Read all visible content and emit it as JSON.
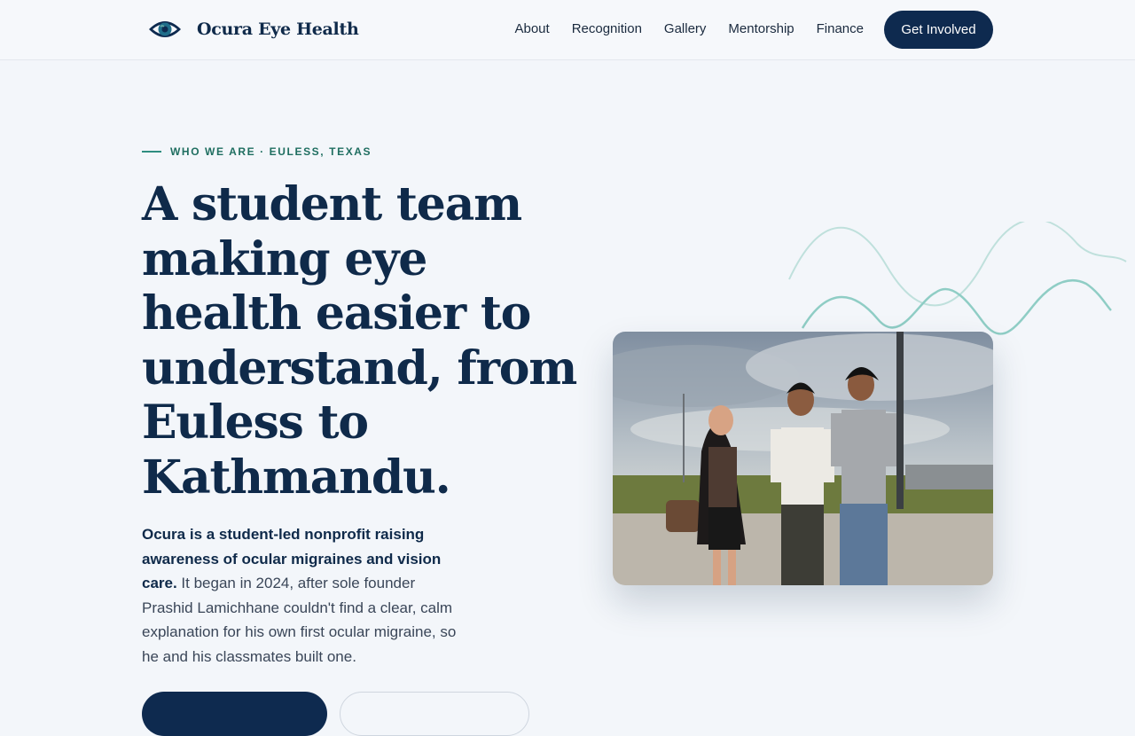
{
  "nav": {
    "brand_name": "Ocura Eye Health",
    "links": [
      "About",
      "Recognition",
      "Gallery",
      "Mentorship",
      "Finance"
    ],
    "cta_label": "Get Involved"
  },
  "hero": {
    "eyebrow": "WHO WE ARE · EULESS, TEXAS",
    "headline": "A student team making eye health easier to understand, from Euless to Kathmandu.",
    "lead_bold": "Ocura is a student-led nonprofit raising awareness of ocular migraines and vision care.",
    "lead_rest": " It began in 2024, after sole founder Prashid Lamichhane couldn't find a clear, calm explanation for his own first ocular migraine, so he and his classmates built one."
  },
  "colors": {
    "navy": "#0e2a4f",
    "teal": "#2f8d80",
    "background": "#f3f6fa"
  }
}
